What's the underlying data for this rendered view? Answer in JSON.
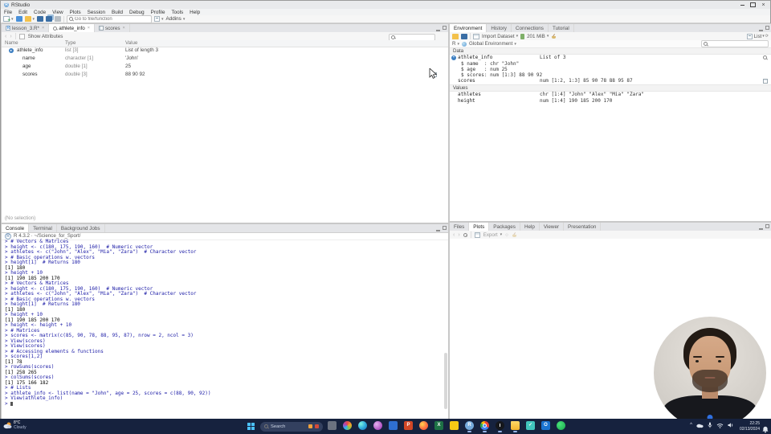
{
  "window": {
    "title": "RStudio"
  },
  "menu": [
    "File",
    "Edit",
    "Code",
    "View",
    "Plots",
    "Session",
    "Build",
    "Debug",
    "Profile",
    "Tools",
    "Help"
  ],
  "main_toolbar": {
    "goto_placeholder": "Go to file/function",
    "addins_label": "Addins"
  },
  "source_pane": {
    "tabs": [
      {
        "label": "lesson_3.R*",
        "icon": "r-doc"
      },
      {
        "label": "athlete_info",
        "icon": "magnifier"
      },
      {
        "label": "scores",
        "icon": "grid2"
      }
    ],
    "active_tab": 1,
    "toolbar": {
      "show_attributes_label": "Show Attributes"
    },
    "grid": {
      "columns": [
        "Name",
        "Type",
        "Value"
      ],
      "rows": [
        {
          "name": "athlete_info",
          "type": "list [3]",
          "value": "List of length 3",
          "expandable": true,
          "indent": 0
        },
        {
          "name": "name",
          "type": "character [1]",
          "value": "'John'",
          "indent": 1
        },
        {
          "name": "age",
          "type": "double [1]",
          "value": "25",
          "indent": 1
        },
        {
          "name": "scores",
          "type": "double [3]",
          "value": "88 90 92",
          "indent": 1,
          "action": "grid"
        }
      ]
    },
    "status_text": "(No selection)"
  },
  "console_pane": {
    "tabs": [
      "Console",
      "Terminal",
      "Background Jobs"
    ],
    "active_tab": 0,
    "version_line": "R 4.3.2 · ~/Science_for_Sport/",
    "lines": [
      {
        "k": "in",
        "t": "> # Vectors & Matrices"
      },
      {
        "k": "in",
        "t": "> height <- c(180, 175, 190, 160)  # Numeric vector"
      },
      {
        "k": "in",
        "t": "> athletes <- c(\"John\", \"Alex\", \"Mia\", \"Zara\")  # Character vector"
      },
      {
        "k": "in",
        "t": "> # Basic operations w. vectors"
      },
      {
        "k": "in",
        "t": "> height[1]  # Returns 180"
      },
      {
        "k": "out",
        "t": "[1] 180"
      },
      {
        "k": "in",
        "t": "> height + 10"
      },
      {
        "k": "out",
        "t": "[1] 190 185 200 170"
      },
      {
        "k": "in",
        "t": "> # Vectors & Matrices"
      },
      {
        "k": "in",
        "t": "> height <- c(180, 175, 190, 160)  # Numeric vector"
      },
      {
        "k": "in",
        "t": "> athletes <- c(\"John\", \"Alex\", \"Mia\", \"Zara\")  # Character vector"
      },
      {
        "k": "in",
        "t": "> # Basic operations w. vectors"
      },
      {
        "k": "in",
        "t": "> height[1]  # Returns 180"
      },
      {
        "k": "out",
        "t": "[1] 180"
      },
      {
        "k": "in",
        "t": "> height + 10"
      },
      {
        "k": "out",
        "t": "[1] 190 185 200 170"
      },
      {
        "k": "in",
        "t": "> height <- height + 10"
      },
      {
        "k": "in",
        "t": "> # Matrices"
      },
      {
        "k": "in",
        "t": "> scores <- matrix(c(85, 90, 78, 88, 95, 87), nrow = 2, ncol = 3)"
      },
      {
        "k": "in",
        "t": "> View(scores)"
      },
      {
        "k": "in",
        "t": "> View(scores)"
      },
      {
        "k": "in",
        "t": "> # Accessing elements & functions"
      },
      {
        "k": "in",
        "t": "> scores[1,2]"
      },
      {
        "k": "out",
        "t": "[1] 78"
      },
      {
        "k": "in",
        "t": "> rowSums(scores)"
      },
      {
        "k": "out",
        "t": "[1] 258 265"
      },
      {
        "k": "in",
        "t": "> colSums(scores)"
      },
      {
        "k": "out",
        "t": "[1] 175 166 182"
      },
      {
        "k": "in",
        "t": "> # Lists"
      },
      {
        "k": "in",
        "t": "> athlete_info <- list(name = \"John\", age = 25, scores = c(88, 90, 92))"
      },
      {
        "k": "in",
        "t": "> View(athlete_info)"
      },
      {
        "k": "in",
        "t": "> ",
        "caret": true
      }
    ]
  },
  "environment_pane": {
    "tabs": [
      "Environment",
      "History",
      "Connections",
      "Tutorial"
    ],
    "active_tab": 0,
    "toolbar": {
      "import_label": "Import Dataset",
      "memory_label": "201 MiB",
      "view_label": "List",
      "engine_label": "R",
      "scope_label": "Global Environment"
    },
    "sections": [
      {
        "header": "Data",
        "rows": [
          {
            "kind": "object",
            "name": "athlete_info",
            "value": "List of 3",
            "expanded": true,
            "action": "magnifier"
          },
          {
            "kind": "detail",
            "text": "$ name  : chr \"John\""
          },
          {
            "kind": "detail",
            "text": "$ age   : num 25"
          },
          {
            "kind": "detail",
            "text": "$ scores: num [1:3] 88 90 92"
          },
          {
            "kind": "object",
            "name": "scores",
            "value": "num [1:2, 1:3] 85 90 78 88 95 87",
            "action": "grid"
          }
        ]
      },
      {
        "header": "Values",
        "rows": [
          {
            "kind": "object",
            "name": "athletes",
            "value": "chr [1:4] \"John\" \"Alex\" \"Mia\" \"Zara\""
          },
          {
            "kind": "object",
            "name": "height",
            "value": "num [1:4] 190 185 200 170"
          }
        ]
      }
    ]
  },
  "files_pane": {
    "tabs": [
      "Files",
      "Plots",
      "Packages",
      "Help",
      "Viewer",
      "Presentation"
    ],
    "active_tab": 1,
    "toolbar": {
      "export_label": "Export"
    }
  },
  "taskbar": {
    "search_label": "Search",
    "clock_time": "22:25",
    "clock_date": "02/13/2024",
    "weather": {
      "temp": "8°C",
      "desc": "Cloudy"
    },
    "accent_colors": {
      "taskbar_bg": "#16223e",
      "search_pill": "#33405f",
      "active_underline": "#97b4e8"
    },
    "apps": [
      {
        "name": "task-view",
        "bg": "#6b7280",
        "shape": "square"
      },
      {
        "name": "photos",
        "bg": "conic-gradient(#e5484d,#f5a524,#8bc34a,#29b6f6,#ab47bc,#e5484d)",
        "shape": "circle"
      },
      {
        "name": "edge-browser",
        "bg": "radial-gradient(circle at 30% 30%, #7df3e1, #38b6e0 45%, #0d62b8)",
        "shape": "circle"
      },
      {
        "name": "paint",
        "bg": "radial-gradient(circle at 35% 35%, #e3b3f0, #9c27b0)",
        "shape": "circle"
      },
      {
        "name": "mail",
        "bg": "#2f6fd0",
        "shape": "square"
      },
      {
        "name": "powerpoint",
        "bg": "#d24726",
        "shape": "square",
        "letter": "P"
      },
      {
        "name": "firefox",
        "bg": "radial-gradient(circle at 35% 35%, #ffd54f, #ff7043 55%, #e64a19)",
        "shape": "circle"
      },
      {
        "name": "excel",
        "bg": "#1e7145",
        "shape": "square",
        "letter": "X"
      },
      {
        "name": "sticky-notes",
        "bg": "#f6c915",
        "shape": "square"
      },
      {
        "name": "rstudio-app",
        "bg": "#75aadb",
        "shape": "circle",
        "letter": "R",
        "underline": true
      },
      {
        "name": "chrome",
        "bg": "conic-gradient(#ea4335 0 33%, #4285f4 0 66%, #34a853 0 85%, #fbbc05 0 100%)",
        "shape": "circle",
        "core": true,
        "underline": true
      },
      {
        "name": "clock-app",
        "bg": "#15171c",
        "shape": "circle",
        "hands": true,
        "underline": true
      },
      {
        "name": "file-explorer",
        "bg": "linear-gradient(#ffd968,#f4b62e)",
        "shape": "folder",
        "underline": true
      },
      {
        "name": "todo",
        "bg": "#41c4bd",
        "shape": "square",
        "letter": "✓"
      },
      {
        "name": "outlook",
        "bg": "#1b74d1",
        "shape": "square",
        "letter": "O"
      },
      {
        "name": "whatsapp",
        "bg": "radial-gradient(circle at 35% 35%, #4ae37a, #18a94d)",
        "shape": "circle"
      }
    ]
  }
}
